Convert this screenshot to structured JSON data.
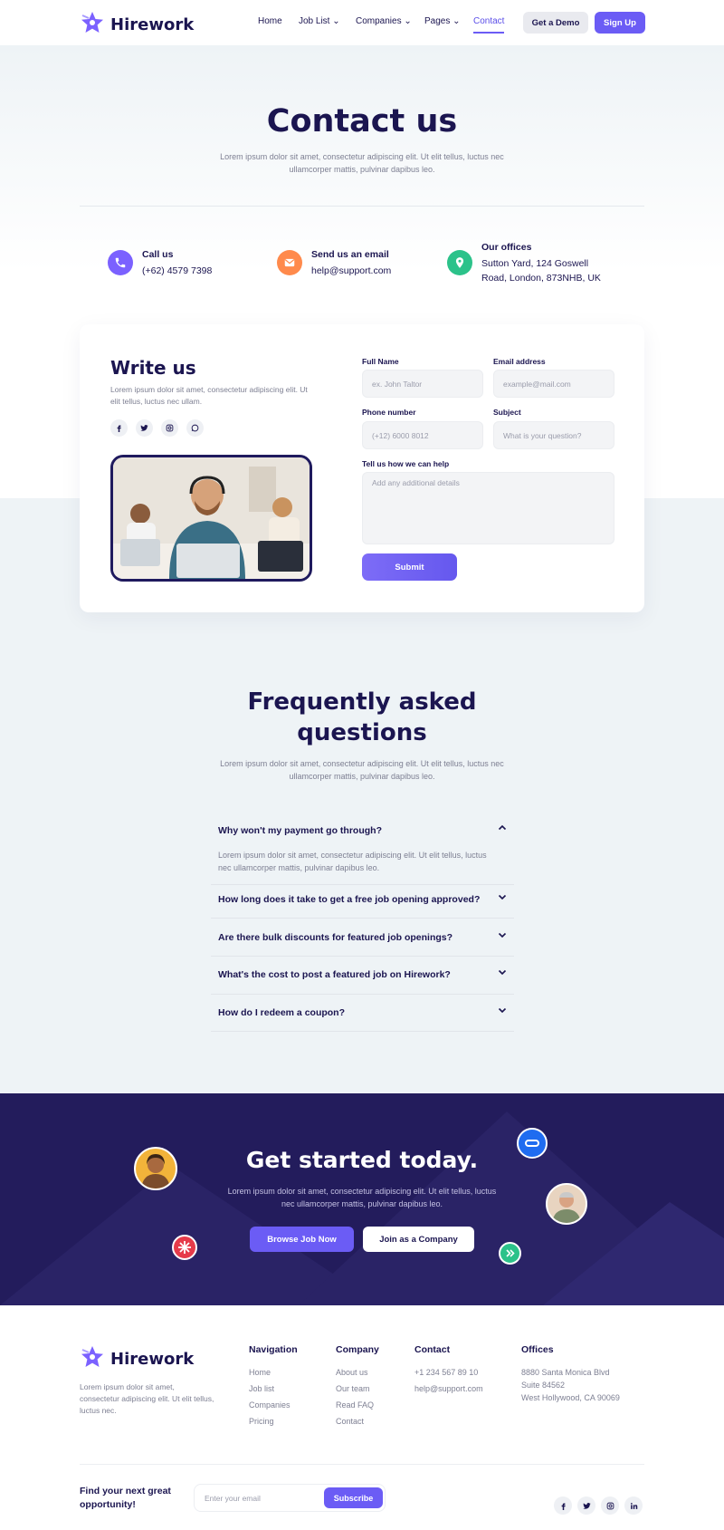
{
  "brand": {
    "name": "Hirework",
    "accent": "#6b5cf5",
    "navy": "#1b1550",
    "cta_bg": "#231c5c"
  },
  "nav": {
    "items": [
      {
        "label": "Home"
      },
      {
        "label": "Job List"
      },
      {
        "label": "Companies"
      },
      {
        "label": "Pages"
      },
      {
        "label": "Contact"
      }
    ],
    "active": "Contact",
    "demo_label": "Get a Demo",
    "signup_label": "Sign Up"
  },
  "hero": {
    "title": "Contact us",
    "subtitle": "Lorem ipsum dolor sit amet, consectetur adipiscing elit. Ut elit tellus, luctus nec ullamcorper mattis, pulvinar dapibus leo."
  },
  "contacts": [
    {
      "icon": "phone-icon",
      "title": "Call us",
      "value": "(+62) 4579 7398",
      "color": "#7b61ff"
    },
    {
      "icon": "mail-icon",
      "title": "Send us an email",
      "value": "help@support.com",
      "color": "#ff8a4c"
    },
    {
      "icon": "location-pin-icon",
      "title": "Our offices",
      "value": "Sutton Yard, 124 Goswell Road, London, 873NHB, UK",
      "color": "#2cc28a"
    }
  ],
  "write": {
    "title": "Write us",
    "subtitle": "Lorem ipsum dolor sit amet, consectetur adipiscing elit. Ut elit tellus, luctus nec ullam.",
    "socials": [
      "facebook-icon",
      "twitter-icon",
      "instagram-icon",
      "whatsapp-icon"
    ]
  },
  "form": {
    "full_name": {
      "label": "Full Name",
      "placeholder": "ex. John Taltor"
    },
    "email": {
      "label": "Email address",
      "placeholder": "example@mail.com"
    },
    "phone": {
      "label": "Phone number",
      "placeholder": "(+12) 6000 8012"
    },
    "subject": {
      "label": "Subject",
      "placeholder": "What is your question?"
    },
    "message": {
      "label": "Tell us how we can help",
      "placeholder": "Add any additional details"
    },
    "submit_label": "Submit"
  },
  "faq": {
    "title_line1": "Frequently asked",
    "title_line2": "questions",
    "subtitle": "Lorem ipsum dolor sit amet, consectetur adipiscing elit. Ut elit tellus, luctus nec ullamcorper mattis, pulvinar dapibus leo.",
    "items": [
      {
        "question": "Why won't my payment go through?",
        "answer": "Lorem ipsum dolor sit amet, consectetur adipiscing elit. Ut elit tellus, luctus nec ullamcorper mattis, pulvinar dapibus leo.",
        "expanded": true
      },
      {
        "question": "How long does it take to get a free job opening approved?",
        "expanded": false
      },
      {
        "question": "Are there bulk discounts for featured job openings?",
        "expanded": false
      },
      {
        "question": "What's the cost to post a featured job on Hirework?",
        "expanded": false
      },
      {
        "question": "How do I redeem a coupon?",
        "expanded": false
      }
    ]
  },
  "cta": {
    "title": "Get started today.",
    "subtitle": "Lorem ipsum dolor sit amet, consectetur adipiscing elit. Ut elit tellus, luctus nec ullamcorper mattis, pulvinar dapibus leo.",
    "browse_label": "Browse Job Now",
    "join_label": "Join as a Company"
  },
  "footer": {
    "brand": "Hirework",
    "description": "Lorem ipsum dolor sit amet, consectetur adipiscing elit. Ut elit tellus, luctus nec.",
    "navigation": {
      "title": "Navigation",
      "links": [
        "Home",
        "Job list",
        "Companies",
        "Pricing"
      ]
    },
    "company": {
      "title": "Company",
      "links": [
        "About us",
        "Our team",
        "Read FAQ",
        "Contact"
      ]
    },
    "contact": {
      "title": "Contact",
      "links": [
        "+1 234 567 89 10",
        "help@support.com"
      ]
    },
    "offices": {
      "title": "Offices",
      "links": [
        "8880 Santa Monica Blvd",
        "Suite 84562",
        "West Hollywood, CA 90069"
      ]
    },
    "newsletter_title": "Find your next great opportunity!",
    "email_placeholder": "Enter your email",
    "subscribe_label": "Subscribe",
    "socials": [
      "facebook-icon",
      "twitter-icon",
      "instagram-icon",
      "linkedin-icon"
    ]
  }
}
